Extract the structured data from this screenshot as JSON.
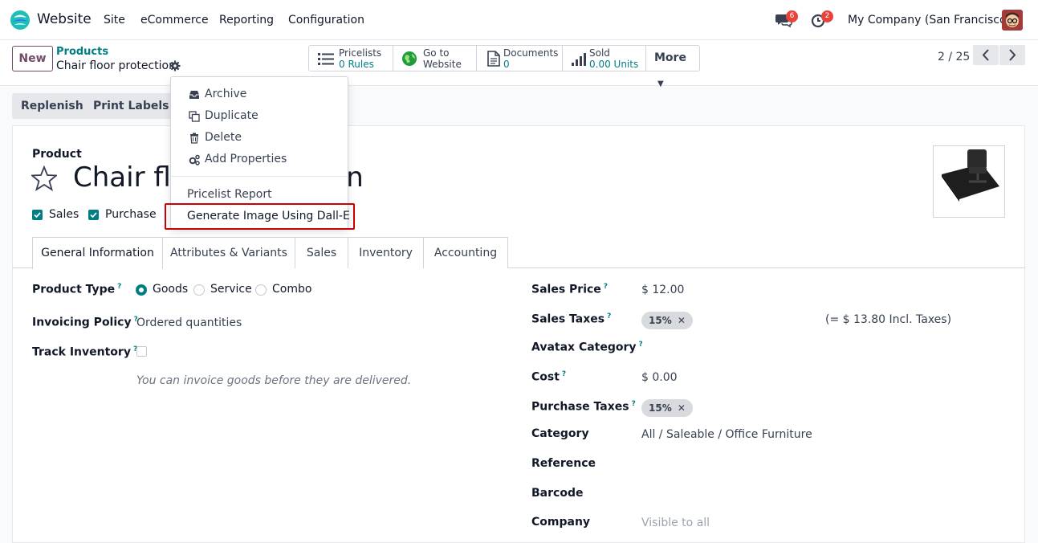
{
  "navbar": {
    "app_name": "Website",
    "menu": [
      "Site",
      "eCommerce",
      "Reporting",
      "Configuration"
    ],
    "messages_count": "6",
    "activities_count": "2",
    "company": "My Company (San Francisco)"
  },
  "control": {
    "new_label": "New",
    "breadcrumb_parent": "Products",
    "breadcrumb_current": "Chair floor protection",
    "smart_buttons": [
      {
        "line1": "Pricelists",
        "line2": "0 Rules",
        "icon": "list-icon"
      },
      {
        "line1": "Go to",
        "line2": "Website",
        "icon": "globe-icon"
      },
      {
        "line1": "Documents",
        "line2": "0",
        "icon": "document-icon"
      },
      {
        "line1": "Sold",
        "line2": "0.00 Units",
        "icon": "bar-chart-icon"
      }
    ],
    "more_label": "More",
    "pager": "2 / 25"
  },
  "actions": {
    "replenish": "Replenish",
    "print_labels": "Print Labels"
  },
  "dropdown": {
    "items": [
      {
        "label": "Archive",
        "icon": "inbox-icon"
      },
      {
        "label": "Duplicate",
        "icon": "copy-icon"
      },
      {
        "label": "Delete",
        "icon": "trash-icon"
      },
      {
        "label": "Add Properties",
        "icon": "cogs-icon"
      }
    ],
    "extra": [
      "Pricelist Report",
      "Generate Image Using Dall-E"
    ]
  },
  "product": {
    "label": "Product",
    "title": "Chair floor protection",
    "sales_label": "Sales",
    "purchase_label": "Purchase",
    "sales_checked": true,
    "purchase_checked": true
  },
  "tabs": [
    "General Information",
    "Attributes & Variants",
    "Sales",
    "Inventory",
    "Accounting"
  ],
  "left_fields": {
    "product_type_label": "Product Type",
    "product_type_options": [
      "Goods",
      "Service",
      "Combo"
    ],
    "product_type_selected": "Goods",
    "invoicing_policy_label": "Invoicing Policy",
    "invoicing_policy_value": "Ordered quantities",
    "track_inventory_label": "Track Inventory",
    "help_text": "You can invoice goods before they are delivered."
  },
  "right_fields": {
    "sales_price_label": "Sales Price",
    "sales_price_value": "$ 12.00",
    "sales_taxes_label": "Sales Taxes",
    "sales_taxes_tag": "15%",
    "incl_taxes": "(= $ 13.80 Incl. Taxes)",
    "avatax_label": "Avatax Category",
    "cost_label": "Cost",
    "cost_value": "$ 0.00",
    "purchase_taxes_label": "Purchase Taxes",
    "purchase_taxes_tag": "15%",
    "category_label": "Category",
    "category_value": "All / Saleable / Office Furniture",
    "reference_label": "Reference",
    "barcode_label": "Barcode",
    "company_label": "Company",
    "company_placeholder": "Visible to all"
  },
  "colors": {
    "accent": "#017e84",
    "brand": "#714b67",
    "highlight": "#cc0000"
  }
}
